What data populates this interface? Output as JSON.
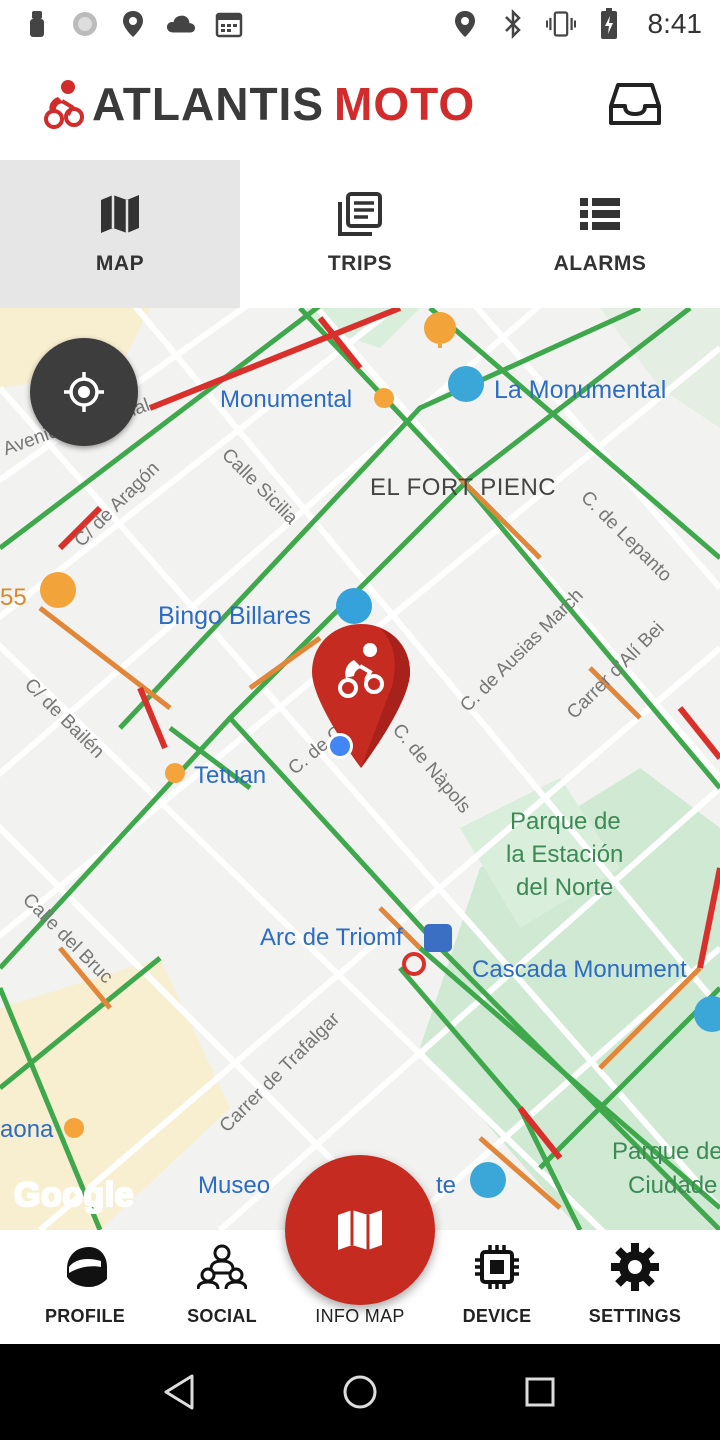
{
  "status_bar": {
    "time": "8:41",
    "left_icons": [
      "usb-icon",
      "sync-icon",
      "location-icon",
      "cloud-icon",
      "calendar-icon"
    ],
    "right_icons": [
      "location-icon",
      "bluetooth-icon",
      "vibrate-icon",
      "battery-icon"
    ]
  },
  "header": {
    "brand_part1": "ATLANTIS",
    "brand_part2": "MOTO",
    "brand_color": "#d12b2b"
  },
  "tabs": [
    {
      "label": "MAP",
      "icon": "map-icon",
      "active": true
    },
    {
      "label": "TRIPS",
      "icon": "trips-icon",
      "active": false
    },
    {
      "label": "ALARMS",
      "icon": "list-icon",
      "active": false
    }
  ],
  "map": {
    "labels": {
      "monumental_station": "Monumental",
      "la_monumental": "La Monumental",
      "el_fort_pienc": "EL FORT PIENC",
      "bingo": "Bingo Billares",
      "tetuan": "Tetuan",
      "parque1": "Parque de",
      "parque2": "la Estación",
      "parque3": "del Norte",
      "arc": "Arc de Triomf",
      "cascada": "Cascada Monument",
      "parque_ciudad1": "Parque de",
      "parque_ciudad2": "Ciudade",
      "museo": "Museo",
      "museo_end": "te",
      "aona": "aona",
      "num55": "55",
      "avenida": "Avenida",
      "gonal": "gonal",
      "c_aragon": "C/ de Aragón",
      "calle_sicilia": "Calle Sicilia",
      "c_lepanto": "C. de Lepanto",
      "c_ausias": "C. de Ausias March",
      "c_alibei": "Carrer d'Alí Bei",
      "c_bailen": "C/ de Bailén",
      "c_napols": "C. de Nàpols",
      "c_de_c": "C. de C",
      "calle_bruc": "Calle del Bruc",
      "c_trafalgar": "Carrer de Trafalgar"
    },
    "attribution": "Google",
    "marker_color": "#c62b22",
    "user_dot_color": "#4285f4"
  },
  "bottom_nav": {
    "profile": "PROFILE",
    "social": "SOCIAL",
    "info_map": "INFO MAP",
    "device": "DEVICE",
    "settings": "SETTINGS"
  },
  "accent_color": "#c62b22"
}
